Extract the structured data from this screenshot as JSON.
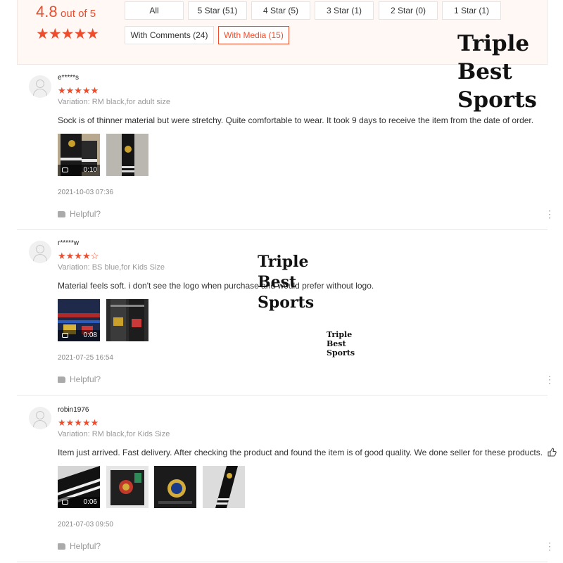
{
  "summary": {
    "score": "4.8",
    "out_of": "out of 5",
    "stars": "★★★★★"
  },
  "filters": [
    {
      "label": "All",
      "active": false
    },
    {
      "label": "5 Star (51)",
      "active": false
    },
    {
      "label": "4 Star (5)",
      "active": false
    },
    {
      "label": "3 Star (1)",
      "active": false
    },
    {
      "label": "2 Star (0)",
      "active": false
    },
    {
      "label": "1 Star (1)",
      "active": false
    },
    {
      "label": "With Comments (24)",
      "active": false
    },
    {
      "label": "With Media (15)",
      "active": true
    }
  ],
  "reviews": [
    {
      "user": "e*****s",
      "stars": "★★★★★",
      "rating": 5,
      "variation": "Variation: RM black,for adult size",
      "text": "Sock is of thinner material but were stretchy. Quite comfortable to wear. It took 9 days to receive the item from the date of order.",
      "video_duration": "0:10",
      "date": "2021-10-03 07:36",
      "helpful": "Helpful?"
    },
    {
      "user": "r*****w",
      "stars": "★★★★☆",
      "rating": 4,
      "variation": "Variation: BS blue,for Kids Size",
      "text": "Material feels soft. i don't see the logo when purchase and would prefer without logo.",
      "video_duration": "0:08",
      "date": "2021-07-25 16:54",
      "helpful": "Helpful?"
    },
    {
      "user": "robin1976",
      "stars": "★★★★★",
      "rating": 5,
      "variation": "Variation: RM black,for Kids Size",
      "text": "Item just arrived. Fast delivery. After checking the product and found the item is of good quality. We done seller for these products.",
      "video_duration": "0:06",
      "date": "2021-07-03 09:50",
      "helpful": "Helpful?"
    }
  ],
  "watermark": {
    "line1": "Triple",
    "line2": "Best",
    "line3": "Sports"
  },
  "colors": {
    "accent": "#ee4d2d",
    "summary_bg": "#fff8f5"
  }
}
